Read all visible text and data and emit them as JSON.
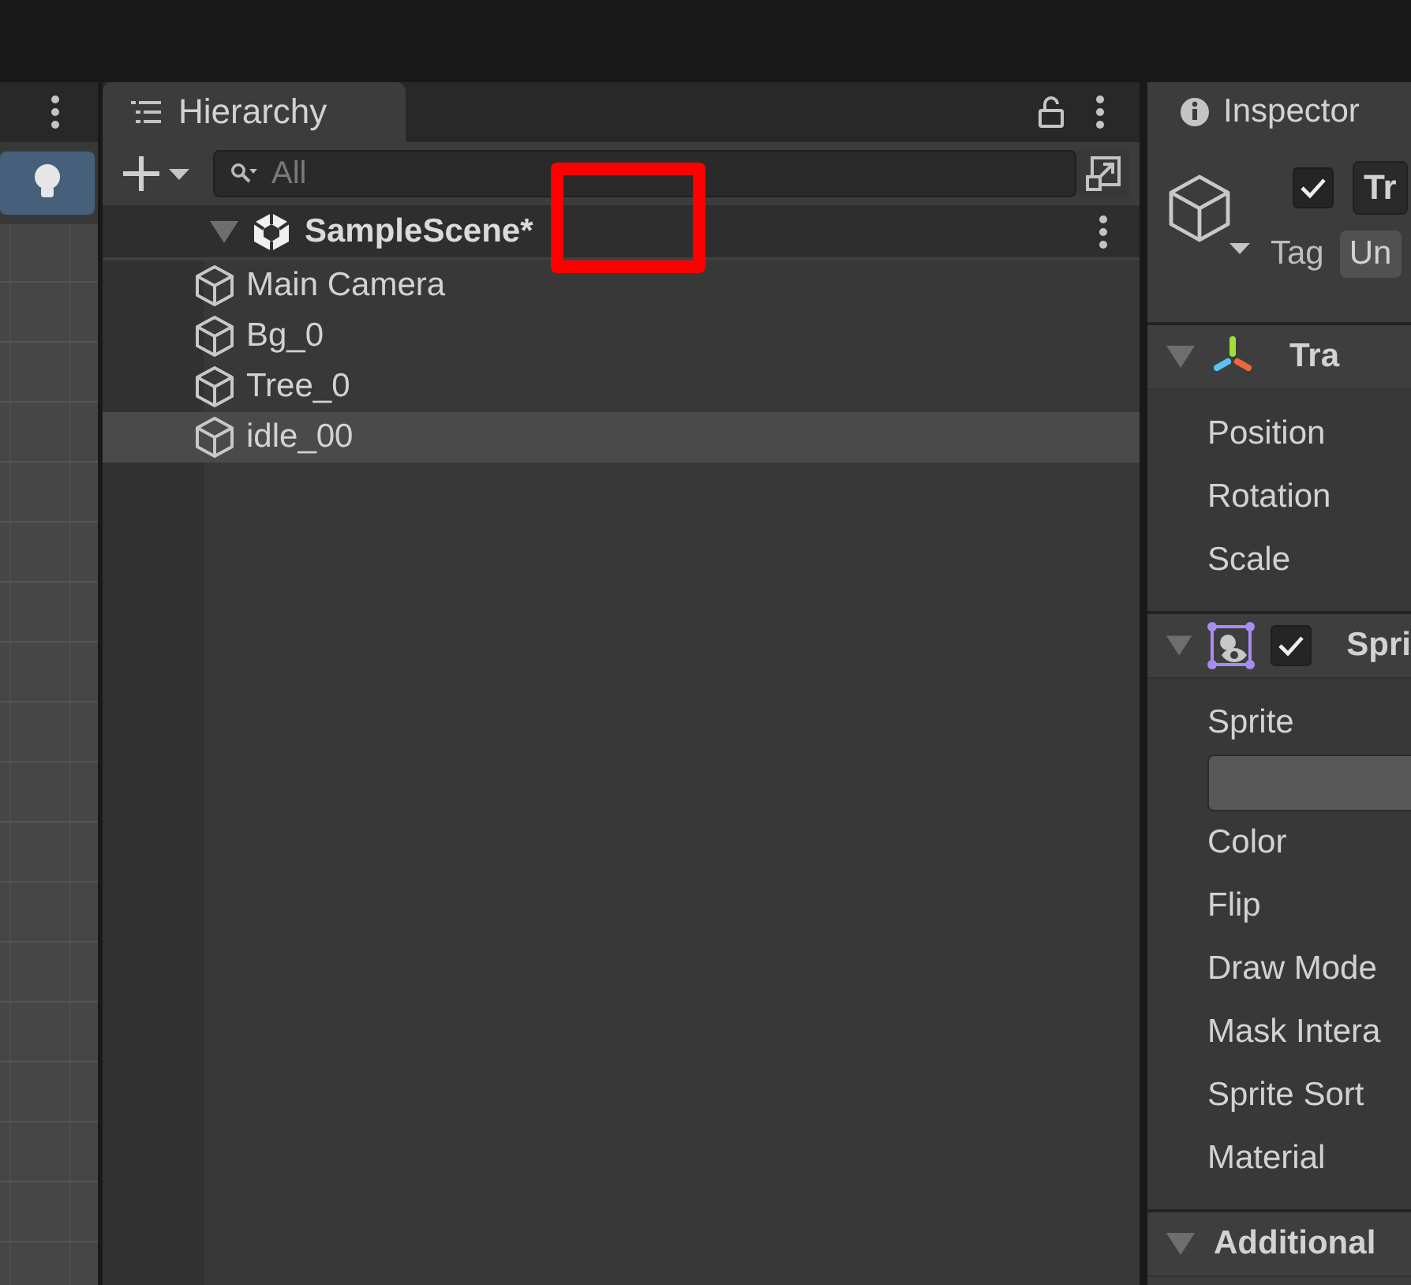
{
  "scene_view": {
    "lighting_on": true
  },
  "hierarchy": {
    "tab": "Hierarchy",
    "search": {
      "placeholder": "All"
    },
    "scene": {
      "name": "SampleScene*",
      "expanded": true,
      "highlighted": true
    },
    "items": [
      {
        "name": "Main Camera",
        "selected": false
      },
      {
        "name": "Bg_0",
        "selected": false
      },
      {
        "name": "Tree_0",
        "selected": false
      },
      {
        "name": "idle_00",
        "selected": true
      }
    ]
  },
  "inspector": {
    "tab": "Inspector",
    "object": {
      "active": true,
      "name": "Tr",
      "tag_label": "Tag",
      "tag": "Un"
    },
    "components": [
      {
        "kind": "transform",
        "title": "Tra",
        "expanded": true,
        "properties": [
          {
            "kind": "row",
            "label": "Position"
          },
          {
            "kind": "row",
            "label": "Rotation"
          },
          {
            "kind": "row",
            "label": "Scale"
          }
        ]
      },
      {
        "kind": "sprite_renderer",
        "title": "Spri",
        "enabled": true,
        "expanded": true,
        "properties": [
          {
            "kind": "object_field",
            "label": "Sprite"
          },
          {
            "kind": "row",
            "label": "Color"
          },
          {
            "kind": "row",
            "label": "Flip"
          },
          {
            "kind": "row",
            "label": "Draw Mode"
          },
          {
            "kind": "row",
            "label": "Mask Intera"
          },
          {
            "kind": "row",
            "label": "Sprite Sort"
          },
          {
            "kind": "row",
            "label": "Material"
          }
        ]
      },
      {
        "kind": "section",
        "title": "Additional",
        "expanded": true
      }
    ]
  }
}
